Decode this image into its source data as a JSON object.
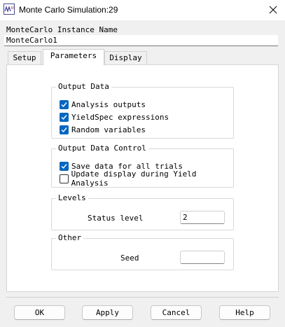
{
  "window": {
    "title": "Monte Carlo Simulation:29",
    "app_icon": "wm-app-icon",
    "close_icon": "close-icon"
  },
  "instance": {
    "label": "MonteCarlo Instance Name",
    "value": "MonteCarlo1"
  },
  "tabs": [
    {
      "label": "Setup",
      "active": false
    },
    {
      "label": "Parameters",
      "active": true
    },
    {
      "label": "Display",
      "active": false
    }
  ],
  "output_data": {
    "title": "Output Data",
    "items": [
      {
        "label": "Analysis outputs",
        "checked": true
      },
      {
        "label": "YieldSpec expressions",
        "checked": true
      },
      {
        "label": "Random variables",
        "checked": true
      }
    ]
  },
  "output_data_control": {
    "title": "Output Data Control",
    "items": [
      {
        "label": "Save data for all trials",
        "checked": true
      },
      {
        "label": "Update display during Yield Analysis",
        "checked": false
      }
    ]
  },
  "levels": {
    "title": "Levels",
    "status_level_label": "Status level",
    "status_level_value": "2"
  },
  "other": {
    "title": "Other",
    "seed_label": "Seed",
    "seed_value": ""
  },
  "buttons": {
    "ok": "OK",
    "apply": "Apply",
    "cancel": "Cancel",
    "help": "Help"
  },
  "colors": {
    "accent": "#0067c0",
    "panel": "#ffffff",
    "background": "#f0f0f0"
  }
}
